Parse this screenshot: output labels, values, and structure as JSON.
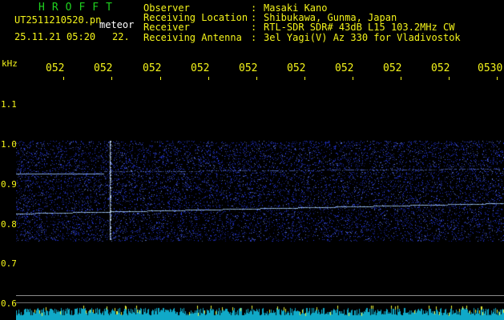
{
  "header": {
    "app_title": "HROFFT",
    "filename": "UT2511210520.pn",
    "meteor_label": "meteor",
    "timestamp": "25.11.21 05:20",
    "frame_number": "22.",
    "info": [
      {
        "key": "Observer",
        "sep": ":",
        "value": "Masaki Kano"
      },
      {
        "key": "Receiving Location",
        "sep": ":",
        "value": "Shibukawa, Gunma, Japan"
      },
      {
        "key": "Receiver",
        "sep": ":",
        "value": "RTL-SDR SDR# 43dB L15 103.2MHz CW"
      },
      {
        "key": "Receiving Antenna",
        "sep": ":",
        "value": "3el Yagi(V) Az 330 for Vladivostok"
      }
    ]
  },
  "spectrogram": {
    "y_unit": "kHz",
    "y_labels": [
      "1.1",
      "1.0",
      "0.9",
      "0.8",
      "0.7",
      "0.6"
    ],
    "x_labels": [
      "052",
      "052",
      "052",
      "052",
      "052",
      "052",
      "052",
      "052",
      "052",
      "0530"
    ],
    "colors": {
      "background": "#000000",
      "text": "#f4f41a",
      "title": "#1fd21f",
      "noise": "#1a2ee6",
      "signal": "#9fd0ff",
      "strip": "#10a9c8",
      "strip_spike": "#e8ee3a"
    }
  }
}
